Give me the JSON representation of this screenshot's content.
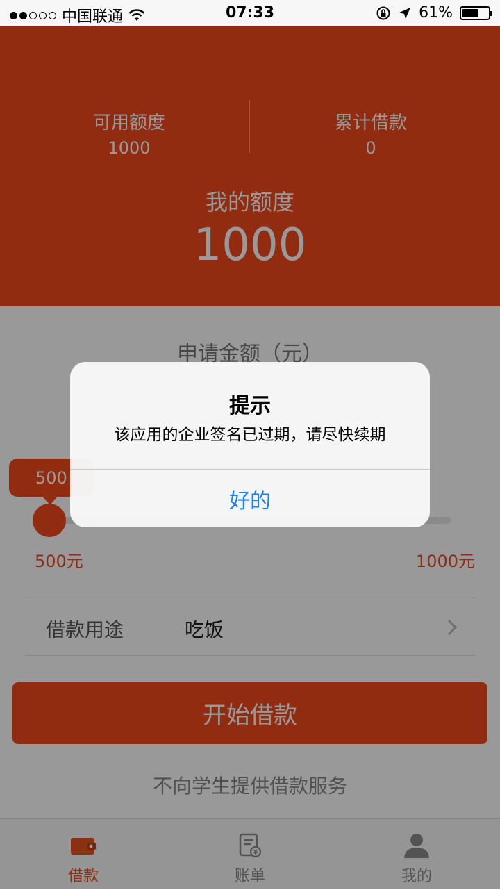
{
  "status_bar": {
    "carrier": "中国联通",
    "time": "07:33",
    "battery": "61%",
    "battery_level": 0.61
  },
  "hero": {
    "available_label": "可用额度",
    "available_value": "1000",
    "total_label": "累计借款",
    "total_value": "0",
    "my_label": "我的额度",
    "my_value": "1000"
  },
  "apply": {
    "title": "申请金额（元）",
    "current": "500",
    "min_label": "500元",
    "max_label": "1000元",
    "level": 0.0
  },
  "purpose": {
    "label": "借款用途",
    "value": "吃饭"
  },
  "start_button": "开始借款",
  "note": "不向学生提供借款服务",
  "tabs": [
    {
      "label": "借款",
      "icon": "wallet-icon",
      "active": true
    },
    {
      "label": "账单",
      "icon": "bill-icon",
      "active": false
    },
    {
      "label": "我的",
      "icon": "user-icon",
      "active": false
    }
  ],
  "alert": {
    "title": "提示",
    "message": "该应用的企业签名已过期，请尽快续期",
    "ok": "好的"
  },
  "colors": {
    "brand": "#f34a1d",
    "link": "#1a7ef7"
  }
}
